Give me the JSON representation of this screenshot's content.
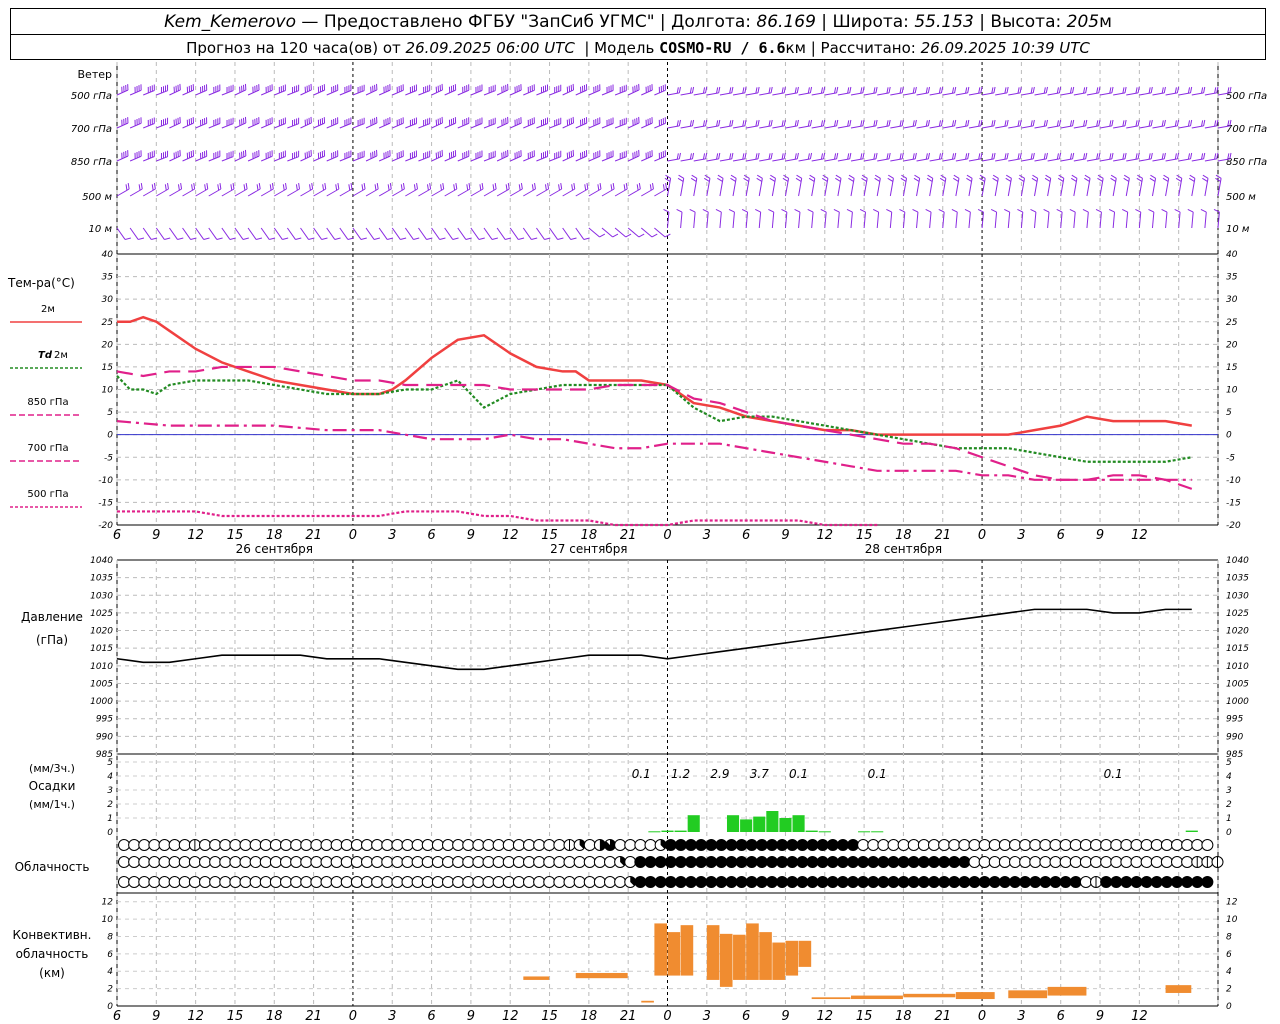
{
  "header": {
    "station": "Kem_Kemerovo",
    "provider": "— Предоставлено ФГБУ \"ЗапСиб УГМС\"",
    "lon_label": "Долгота:",
    "lon": "86.169",
    "lat_label": "Широта:",
    "lat": "55.153",
    "alt_label": "Высота:",
    "alt": "205",
    "alt_unit": "м",
    "forecast_label": "Прогноз на 120 часа(ов) от",
    "forecast_start": "26.09.2025 06:00 UTC",
    "model_label": "Модель",
    "model": "COSMO-RU / 6.6",
    "model_unit": "км",
    "calc_label": "Рассчитано:",
    "calc_time": "26.09.2025 10:39 UTC"
  },
  "time_axis": {
    "hour_labels": [
      "6",
      "9",
      "12",
      "15",
      "18",
      "21",
      "0",
      "3",
      "6",
      "9",
      "12",
      "15",
      "18",
      "21",
      "0",
      "3",
      "6",
      "9",
      "12",
      "15",
      "18",
      "21",
      "0",
      "3",
      "6",
      "9",
      "12"
    ],
    "date_labels": [
      {
        "label": "26 сентября",
        "hour": 6
      },
      {
        "label": "27 сентября",
        "hour": 30
      },
      {
        "label": "28 сентября",
        "hour": 54
      }
    ]
  },
  "wind_panel": {
    "title": "Ветер",
    "levels": [
      "500 гПа",
      "700 гПа",
      "850 гПа",
      "500  м",
      "10  м"
    ],
    "color": "#8a2be2"
  },
  "chart_data": [
    {
      "type": "line",
      "name": "temperature",
      "ylabel": "Тем-ра(°C)",
      "ylim": [
        -20,
        40
      ],
      "yticks": [
        -20,
        -15,
        -10,
        -5,
        0,
        5,
        10,
        15,
        20,
        25,
        30,
        35,
        40
      ],
      "x_unit": "hours since 26.09.2025 00 UTC",
      "series": [
        {
          "name": "2м",
          "color": "#f04040",
          "style": "solid",
          "x": [
            6,
            7,
            8,
            9,
            10,
            12,
            14,
            16,
            18,
            20,
            22,
            24,
            26,
            27,
            28,
            30,
            32,
            34,
            36,
            38,
            40,
            41,
            42,
            44,
            46,
            48,
            50,
            52,
            54,
            56,
            58,
            60,
            62,
            64,
            66,
            68,
            70,
            72,
            73,
            74,
            76,
            78,
            80,
            82,
            84,
            86,
            88
          ],
          "y": [
            25,
            25,
            26,
            25,
            23,
            19,
            16,
            14,
            12,
            11,
            10,
            9,
            9,
            10,
            12,
            17,
            21,
            22,
            18,
            15,
            14,
            14,
            12,
            12,
            12,
            11,
            7,
            6,
            4,
            3,
            2,
            1,
            1,
            0,
            0,
            0,
            0,
            0,
            0,
            0,
            1,
            2,
            4,
            3,
            3,
            3,
            2
          ]
        },
        {
          "name": "Td 2м",
          "color": "#228b22",
          "style": "dotted",
          "x": [
            6,
            7,
            8,
            9,
            10,
            12,
            14,
            16,
            18,
            20,
            22,
            24,
            26,
            28,
            30,
            32,
            34,
            36,
            38,
            40,
            42,
            44,
            46,
            48,
            50,
            52,
            54,
            56,
            58,
            60,
            62,
            64,
            66,
            68,
            70,
            72,
            74,
            76,
            78,
            80,
            82,
            84,
            86,
            88
          ],
          "y": [
            13,
            10,
            10,
            9,
            11,
            12,
            12,
            12,
            11,
            10,
            9,
            9,
            9,
            10,
            10,
            12,
            6,
            9,
            10,
            11,
            11,
            11,
            11,
            11,
            6,
            3,
            4,
            4,
            3,
            2,
            1,
            0,
            -1,
            -2,
            -3,
            -3,
            -3,
            -4,
            -5,
            -6,
            -6,
            -6,
            -6,
            -5
          ]
        },
        {
          "name": "850 гПа",
          "color": "#e0208a",
          "style": "dashed",
          "x": [
            6,
            8,
            10,
            12,
            14,
            16,
            18,
            20,
            22,
            24,
            26,
            28,
            30,
            32,
            34,
            36,
            38,
            40,
            42,
            44,
            46,
            48,
            50,
            52,
            54,
            56,
            58,
            60,
            62,
            64,
            66,
            68,
            70,
            72,
            74,
            76,
            78,
            80,
            82,
            84,
            86,
            88
          ],
          "y": [
            14,
            13,
            14,
            14,
            15,
            15,
            15,
            14,
            13,
            12,
            12,
            11,
            11,
            11,
            11,
            10,
            10,
            10,
            10,
            11,
            11,
            11,
            8,
            7,
            5,
            3,
            2,
            1,
            0,
            -1,
            -2,
            -2,
            -3,
            -5,
            -7,
            -9,
            -10,
            -10,
            -9,
            -9,
            -10,
            -12
          ]
        },
        {
          "name": "700 гПа",
          "color": "#e0208a",
          "style": "dashdot",
          "x": [
            6,
            10,
            14,
            18,
            22,
            24,
            26,
            28,
            30,
            32,
            34,
            36,
            38,
            40,
            42,
            44,
            46,
            48,
            50,
            52,
            54,
            56,
            58,
            60,
            62,
            64,
            66,
            68,
            70,
            72,
            74,
            76,
            78,
            80,
            82,
            84,
            86,
            88
          ],
          "y": [
            3,
            2,
            2,
            2,
            1,
            1,
            1,
            0,
            -1,
            -1,
            -1,
            0,
            -1,
            -1,
            -2,
            -3,
            -3,
            -2,
            -2,
            -2,
            -3,
            -4,
            -5,
            -6,
            -7,
            -8,
            -8,
            -8,
            -8,
            -9,
            -9,
            -10,
            -10,
            -10,
            -10,
            -10,
            -10,
            -10
          ]
        },
        {
          "name": "500 гПа",
          "color": "#e0208a",
          "style": "dotted",
          "x": [
            6,
            8,
            10,
            12,
            14,
            16,
            18,
            20,
            22,
            24,
            26,
            28,
            30,
            32,
            34,
            36,
            38,
            40,
            42,
            44,
            46,
            48,
            50,
            52,
            54,
            56,
            58,
            60,
            62,
            64
          ],
          "y": [
            -17,
            -17,
            -17,
            -17,
            -18,
            -18,
            -18,
            -18,
            -18,
            -18,
            -18,
            -17,
            -17,
            -17,
            -18,
            -18,
            -19,
            -19,
            -19,
            -20,
            -20,
            -20,
            -19,
            -19,
            -19,
            -19,
            -19,
            -20,
            -20,
            -20
          ]
        }
      ]
    },
    {
      "type": "line",
      "name": "pressure",
      "ylabel": "Давление",
      "yunit": "(гПа)",
      "ylim": [
        985,
        1040
      ],
      "yticks": [
        985,
        990,
        995,
        1000,
        1005,
        1010,
        1015,
        1020,
        1025,
        1030,
        1035,
        1040
      ],
      "series": [
        {
          "name": "Давление",
          "color": "#000000",
          "x": [
            6,
            8,
            10,
            12,
            14,
            16,
            18,
            20,
            22,
            24,
            26,
            28,
            30,
            32,
            34,
            36,
            38,
            40,
            42,
            44,
            46,
            48,
            50,
            52,
            54,
            56,
            58,
            60,
            62,
            64,
            66,
            68,
            70,
            72,
            74,
            76,
            78,
            80,
            82,
            84,
            86,
            88
          ],
          "y": [
            1012,
            1011,
            1011,
            1012,
            1013,
            1013,
            1013,
            1013,
            1012,
            1012,
            1012,
            1011,
            1010,
            1009,
            1009,
            1010,
            1011,
            1012,
            1013,
            1013,
            1013,
            1012,
            1013,
            1014,
            1015,
            1016,
            1017,
            1018,
            1019,
            1020,
            1021,
            1022,
            1023,
            1024,
            1025,
            1026,
            1026,
            1026,
            1025,
            1025,
            1026,
            1026
          ]
        }
      ]
    },
    {
      "type": "bar",
      "name": "precipitation",
      "ylabel": "Осадки",
      "yunit_top": "(мм/3ч.)",
      "yunit_bottom": "(мм/1ч.)",
      "ylim": [
        0,
        5
      ],
      "yticks": [
        0,
        1,
        2,
        3,
        4,
        5
      ],
      "color": "#22cc22",
      "x": [
        47,
        48,
        49,
        50,
        51,
        52,
        53,
        54,
        55,
        56,
        57,
        58,
        59,
        60,
        61,
        62,
        63,
        64,
        65,
        66,
        67,
        68,
        69,
        70,
        71,
        72,
        73,
        74,
        75,
        76,
        77,
        78,
        79,
        80,
        81,
        82,
        83,
        84,
        85,
        86,
        87,
        88
      ],
      "values": [
        0.05,
        0.1,
        0.1,
        1.2,
        0,
        0,
        1.2,
        0.9,
        1.1,
        1.5,
        1.0,
        1.2,
        0.1,
        0.05,
        0,
        0,
        0.05,
        0.05,
        0,
        0,
        0,
        0,
        0,
        0,
        0,
        0,
        0,
        0,
        0,
        0,
        0,
        0,
        0,
        0,
        0,
        0,
        0,
        0,
        0,
        0,
        0,
        0.1
      ],
      "labels_3h": [
        {
          "hour": 46,
          "text": "0.1"
        },
        {
          "hour": 49,
          "text": "1.2"
        },
        {
          "hour": 52,
          "text": "2.9"
        },
        {
          "hour": 55,
          "text": "3.7"
        },
        {
          "hour": 58,
          "text": "0.1"
        },
        {
          "hour": 64,
          "text": "0.1"
        },
        {
          "hour": 82,
          "text": "0.1"
        }
      ]
    },
    {
      "type": "bar",
      "name": "convective_cloud",
      "ylabel": "Конвективн.",
      "ylabel2": "облачность",
      "yunit": "(км)",
      "ylim": [
        0,
        13
      ],
      "yticks": [
        0,
        2,
        4,
        6,
        8,
        10,
        12
      ],
      "color": "#f08c30",
      "bars": [
        {
          "x0": 46,
          "x1": 47,
          "bottom": 0.4,
          "top": 0.6
        },
        {
          "x0": 37,
          "x1": 39,
          "bottom": 3.0,
          "top": 3.4
        },
        {
          "x0": 41,
          "x1": 45,
          "bottom": 3.2,
          "top": 3.8
        },
        {
          "x0": 47,
          "x1": 48,
          "bottom": 3.5,
          "top": 9.5
        },
        {
          "x0": 48,
          "x1": 49,
          "bottom": 3.5,
          "top": 8.5
        },
        {
          "x0": 49,
          "x1": 50,
          "bottom": 3.5,
          "top": 9.3
        },
        {
          "x0": 51,
          "x1": 52,
          "bottom": 3.0,
          "top": 9.3
        },
        {
          "x0": 52,
          "x1": 53,
          "bottom": 2.2,
          "top": 8.3
        },
        {
          "x0": 53,
          "x1": 54,
          "bottom": 3.0,
          "top": 8.2
        },
        {
          "x0": 54,
          "x1": 55,
          "bottom": 3.0,
          "top": 9.5
        },
        {
          "x0": 55,
          "x1": 56,
          "bottom": 3.0,
          "top": 8.5
        },
        {
          "x0": 56,
          "x1": 57,
          "bottom": 3.0,
          "top": 7.3
        },
        {
          "x0": 57,
          "x1": 58,
          "bottom": 3.5,
          "top": 7.5
        },
        {
          "x0": 58,
          "x1": 59,
          "bottom": 4.5,
          "top": 7.5
        },
        {
          "x0": 59,
          "x1": 62,
          "bottom": 0.8,
          "top": 1.0
        },
        {
          "x0": 62,
          "x1": 66,
          "bottom": 0.8,
          "top": 1.2
        },
        {
          "x0": 66,
          "x1": 70,
          "bottom": 1.0,
          "top": 1.4
        },
        {
          "x0": 70,
          "x1": 73,
          "bottom": 0.8,
          "top": 1.6
        },
        {
          "x0": 74,
          "x1": 77,
          "bottom": 0.9,
          "top": 1.8
        },
        {
          "x0": 77,
          "x1": 80,
          "bottom": 1.2,
          "top": 2.2
        },
        {
          "x0": 86,
          "x1": 88,
          "bottom": 1.5,
          "top": 2.4
        }
      ]
    }
  ],
  "clouds": {
    "title": "Облачность",
    "rows": [
      {
        "name": "upper",
        "symbols": "000000020000000000000000000000000000000000002304700003888888888888888888800000000000000000000000000000000000"
      },
      {
        "name": "middle",
        "symbols": "000000000000000000000000000000000000000000000000030888888888888888888888888888888888000000000000000000000022222"
      },
      {
        "name": "lower",
        "symbols": "000000000000000000000000000000000000000000000000003888888888888888888888888888888888888888888880188888888888"
      }
    ]
  },
  "legend": {
    "t2m": "2м",
    "td": "Td",
    "td_suffix": "2м",
    "t850": "850 гПа",
    "t700": "700 гПа",
    "t500": "500 гПа"
  }
}
